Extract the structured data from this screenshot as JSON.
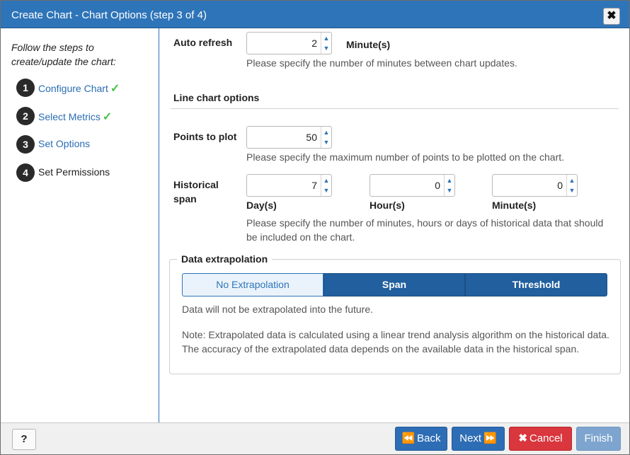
{
  "dialog": {
    "title": "Create Chart - Chart Options (step 3 of 4)",
    "close_label": "✖"
  },
  "sidebar": {
    "intro": "Follow the steps to create/update the chart:",
    "steps": [
      {
        "number": "1",
        "label": "Configure Chart",
        "check": "✓",
        "completed": true
      },
      {
        "number": "2",
        "label": "Select Metrics",
        "check": "✓",
        "completed": true
      },
      {
        "number": "3",
        "label": "Set Options",
        "check": "",
        "completed": false
      },
      {
        "number": "4",
        "label": "Set Permissions",
        "check": "",
        "completed": false
      }
    ]
  },
  "form": {
    "auto_refresh": {
      "label": "Auto refresh",
      "value": "2",
      "unit": "Minute(s)",
      "help": "Please specify the number of minutes between chart updates."
    },
    "line_chart_options": {
      "heading": "Line chart options"
    },
    "points_to_plot": {
      "label": "Points to plot",
      "value": "50",
      "help": "Please specify the maximum number of points to be plotted on the chart."
    },
    "historical_span": {
      "label_line1": "Historical",
      "label_line2": "span",
      "days": {
        "value": "7",
        "unit": "Day(s)"
      },
      "hours": {
        "value": "0",
        "unit": "Hour(s)"
      },
      "minutes": {
        "value": "0",
        "unit": "Minute(s)"
      },
      "help_line1": "Please specify the number of minutes, hours or days of historical data that should",
      "help_line2": "be included on the chart."
    },
    "data_extrapolation": {
      "legend": "Data extrapolation",
      "options": [
        "No Extrapolation",
        "Span",
        "Threshold"
      ],
      "selected": "No Extrapolation",
      "description": "Data will not be extrapolated into the future.",
      "note_line1": "Note: Extrapolated data is calculated using a linear trend analysis algorithm on the historical data.",
      "note_line2": "The accuracy of the extrapolated data depends on the available data in the historical span."
    },
    "spinner_up": "▲",
    "spinner_down": "▼"
  },
  "footer": {
    "help_label": "?",
    "back_label": "Back",
    "back_icon": "⏪",
    "next_label": "Next",
    "next_icon": "⏩",
    "cancel_label": "Cancel",
    "cancel_icon": "✖",
    "finish_label": "Finish"
  },
  "colors": {
    "titlebar": "#2e74b8",
    "link": "#2a6db3",
    "check": "#47c147",
    "primary_button": "#2d6db5",
    "cancel_button": "#d9363e",
    "finish_button_disabled": "#7ea5cf"
  }
}
